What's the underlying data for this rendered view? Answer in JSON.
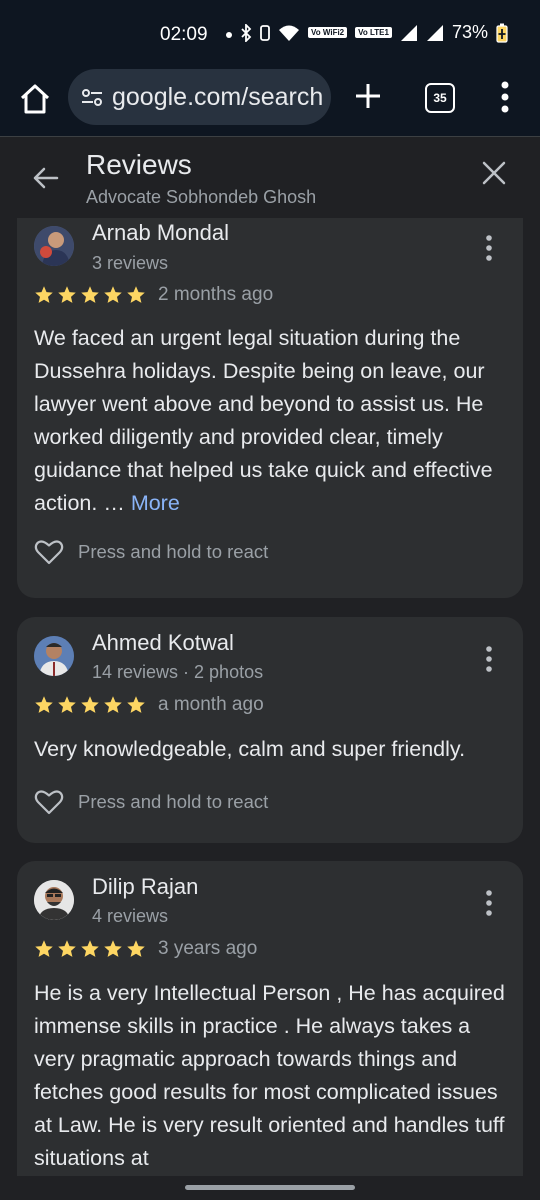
{
  "status_bar": {
    "time": "02:09",
    "wifi_chip": "Vo WiFi2",
    "lte_chip": "Vo LTE1",
    "battery": "73%"
  },
  "browser": {
    "url": "google.com/search",
    "tab_count": "35"
  },
  "sheet": {
    "title": "Reviews",
    "subtitle": "Advocate Sobhondeb Ghosh"
  },
  "reviews": [
    {
      "name": "Arnab Mondal",
      "meta": "3 reviews",
      "rating": 5,
      "date": "2 months ago",
      "text": "We faced an urgent legal situation during the Dussehra holidays. Despite being on leave, our lawyer went above and beyond to assist us. He worked diligently and provided clear, timely guidance that helped us take quick and effective action. …",
      "more_label": "More",
      "react_label": "Press and hold to react"
    },
    {
      "name": "Ahmed Kotwal",
      "meta": "14 reviews · 2 photos",
      "rating": 5,
      "date": "a month ago",
      "text": "Very knowledgeable, calm and super friendly.",
      "react_label": "Press and hold to react"
    },
    {
      "name": "Dilip Rajan",
      "meta": "4 reviews",
      "rating": 5,
      "date": "3 years ago",
      "text": "He is a very Intellectual Person , He has acquired immense skills in practice . He always takes a very pragmatic approach towards things and fetches good results for most complicated issues at Law. He is very result oriented and handles tuff situations at"
    }
  ],
  "colors": {
    "star": "#fdd663",
    "link": "#8ab4f8",
    "card": "#2d2f31",
    "background": "#202124"
  }
}
